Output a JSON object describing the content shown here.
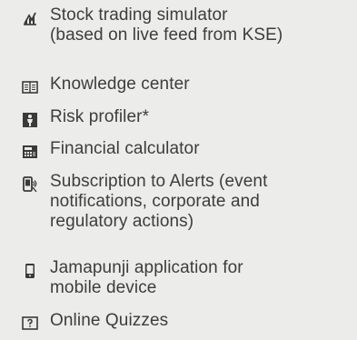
{
  "menu": {
    "items": [
      {
        "label": "Stock trading simulator\n(based on live feed from KSE)",
        "icon": "chart-icon"
      },
      {
        "label": "Knowledge center",
        "icon": "open-book-icon"
      },
      {
        "label": "Risk profiler*",
        "icon": "risk-figure-icon"
      },
      {
        "label": "Financial calculator",
        "icon": "calculator-icon"
      },
      {
        "label": "Subscription to Alerts (event\nnotifications, corporate and\nregulatory actions)",
        "icon": "alert-phone-icon"
      },
      {
        "label": "Jamapunji application for\nmobile device",
        "icon": "mobile-phone-icon"
      },
      {
        "label": "Online Quizzes",
        "icon": "quiz-icon"
      }
    ]
  }
}
